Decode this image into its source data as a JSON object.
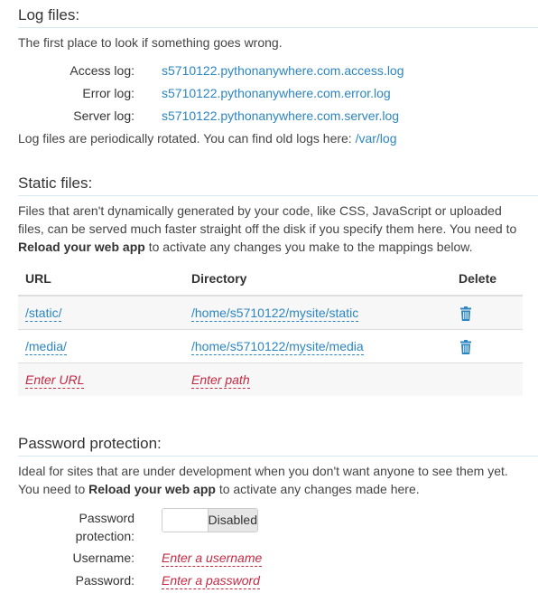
{
  "log_files": {
    "title": "Log files:",
    "description": "The first place to look if something goes wrong.",
    "entries": [
      {
        "label": "Access log:",
        "value": "s5710122.pythonanywhere.com.access.log"
      },
      {
        "label": "Error log:",
        "value": "s5710122.pythonanywhere.com.error.log"
      },
      {
        "label": "Server log:",
        "value": "s5710122.pythonanywhere.com.server.log"
      }
    ],
    "rotation_text": "Log files are periodically rotated. You can find old logs here: ",
    "old_logs_link": "/var/log"
  },
  "static_files": {
    "title": "Static files:",
    "description_1": "Files that aren't dynamically generated by your code, like CSS, JavaScript or uploaded files, can be served much faster straight off the disk if you specify them here. You need to ",
    "reload_label": "Reload your web app",
    "description_2": " to activate any changes you make to the mappings below.",
    "columns": {
      "url": "URL",
      "directory": "Directory",
      "delete": "Delete"
    },
    "rows": [
      {
        "url": "/static/",
        "directory": "/home/s5710122/mysite/static",
        "delete_icon": "trash-icon"
      },
      {
        "url": "/media/",
        "directory": "/home/s5710122/mysite/media",
        "delete_icon": "trash-icon"
      }
    ],
    "new_row": {
      "url_placeholder": "Enter URL",
      "path_placeholder": "Enter path"
    }
  },
  "password_protection": {
    "title": "Password protection:",
    "description_1": "Ideal for sites that are under development when you don't want anyone to see them yet. You need to ",
    "reload_label": "Reload your web app",
    "description_2": " to activate any changes made here.",
    "toggle_label_line1": "Password",
    "toggle_label_line2": "protection:",
    "toggle_state": "Disabled",
    "username_label": "Username:",
    "username_placeholder": "Enter a username",
    "password_label": "Password:",
    "password_placeholder": "Enter a password"
  },
  "colors": {
    "link": "#2c86c1",
    "placeholder": "#c32a42",
    "row_alt": "#f7f7f7"
  }
}
